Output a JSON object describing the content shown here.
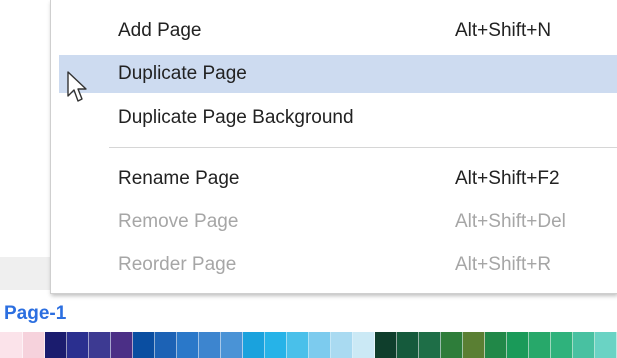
{
  "context_menu": {
    "items": [
      {
        "label": "Add Page",
        "shortcut": "Alt+Shift+N",
        "enabled": true,
        "highlighted": false
      },
      {
        "label": "Duplicate Page",
        "shortcut": "",
        "enabled": true,
        "highlighted": true
      },
      {
        "label": "Duplicate Page Background",
        "shortcut": "",
        "enabled": true,
        "highlighted": false
      },
      {
        "label": "Rename Page",
        "shortcut": "Alt+Shift+F2",
        "enabled": true,
        "highlighted": false
      },
      {
        "label": "Remove Page",
        "shortcut": "Alt+Shift+Del",
        "enabled": false,
        "highlighted": false
      },
      {
        "label": "Reorder Page",
        "shortcut": "Alt+Shift+R",
        "enabled": false,
        "highlighted": false
      }
    ]
  },
  "page_tab": {
    "label": "Page-1"
  },
  "colors": {
    "highlight": "#cddbf0",
    "disabled_text": "#a6a6a6",
    "page_label": "#2c6fe0"
  },
  "palette": [
    "#fbe3ea",
    "#f6d2dc",
    "#1b1c6e",
    "#2a2f8f",
    "#3d3a92",
    "#4b2f86",
    "#0a4ea1",
    "#1c62b5",
    "#2a78c9",
    "#3d85cf",
    "#4a93d6",
    "#1aa2dd",
    "#26b3e8",
    "#49c0ea",
    "#7ccbee",
    "#a9daf1",
    "#cbe9f5",
    "#0f3e2c",
    "#155a3c",
    "#1e6e47",
    "#2e7d3a",
    "#5a7f33",
    "#218848",
    "#1a9a59",
    "#27a86a",
    "#2fb27c",
    "#48c1a1",
    "#6ad3c4"
  ]
}
